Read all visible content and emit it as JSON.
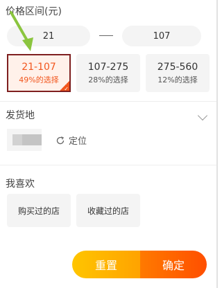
{
  "price_section": {
    "title": "价格区间(元)",
    "min_value": "21",
    "max_value": "107",
    "ranges": [
      {
        "range": "21-107",
        "pct": "49%的选择",
        "selected": true
      },
      {
        "range": "107-275",
        "pct": "28%的选择",
        "selected": false
      },
      {
        "range": "275-560",
        "pct": "12%的选择",
        "selected": false
      }
    ]
  },
  "shipping_section": {
    "title": "发货地",
    "locate_label": "定位"
  },
  "like_section": {
    "title": "我喜欢",
    "options": [
      "购买过的店",
      "收藏过的店"
    ]
  },
  "actions": {
    "reset_label": "重置",
    "confirm_label": "确定"
  },
  "colors": {
    "accent": "#f2561d",
    "selected_border": "#7e1f1f",
    "reset_bg": "#ffb300",
    "confirm_bg": "#ff5a00",
    "annotation_arrow": "#8bc53f"
  }
}
